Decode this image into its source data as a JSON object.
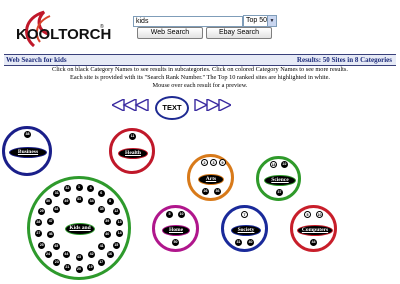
{
  "logo": {
    "text": "KOOLTORCH",
    "trademark": "®"
  },
  "search": {
    "value": "kids"
  },
  "scope_select": {
    "selected": "Top 50"
  },
  "buttons": {
    "web_search": "Web Search",
    "ebay_search": "Ebay Search"
  },
  "results_header": {
    "left": "Web Search for kids",
    "right": "Results: 50 Sites in 8 Categories"
  },
  "instructions": {
    "line1": "Click on black Category Names to see results in subcategories.  Click on colored Category Names to see more results.",
    "line2": "Each site is provided with its \"Search Rank Number.\"  The Top 10 ranked sites are highlighted in white.",
    "line3": "Mouse over each result for a preview."
  },
  "nav": {
    "toggle_label": "TEXT"
  },
  "categories": [
    {
      "name": "Business",
      "color": "#1a1f8a",
      "dots": [
        "38"
      ]
    },
    {
      "name": "Health",
      "color": "#c0182a",
      "dots": [
        "11"
      ]
    },
    {
      "name": "Arts",
      "color": "#d87a1a",
      "dots": [
        "2",
        "3",
        "9",
        "26",
        "36"
      ]
    },
    {
      "name": "Science",
      "color": "#2f9a2a",
      "dots": [
        "18",
        "22",
        "37"
      ]
    },
    {
      "name": "Kids and",
      "color": "#2e9a2c",
      "dots": [
        "1",
        "4",
        "6",
        "8",
        "12",
        "13",
        "14",
        "15",
        "16",
        "17",
        "19",
        "20",
        "21",
        "23",
        "24",
        "25",
        "27",
        "28",
        "29",
        "30",
        "31",
        "32",
        "33",
        "34",
        "35",
        "39",
        "40",
        "41",
        "42",
        "43",
        "44",
        "45",
        "46",
        "47",
        "48",
        "49"
      ]
    },
    {
      "name": "Home",
      "color": "#b0168c",
      "dots": [
        "5",
        "10",
        "50"
      ]
    },
    {
      "name": "Society",
      "color": "#1a2a9a",
      "dots": [
        "7",
        "31",
        "40"
      ]
    },
    {
      "name": "Computers",
      "color": "#c81e2a",
      "dots": [
        "5",
        "10",
        "44"
      ]
    }
  ]
}
